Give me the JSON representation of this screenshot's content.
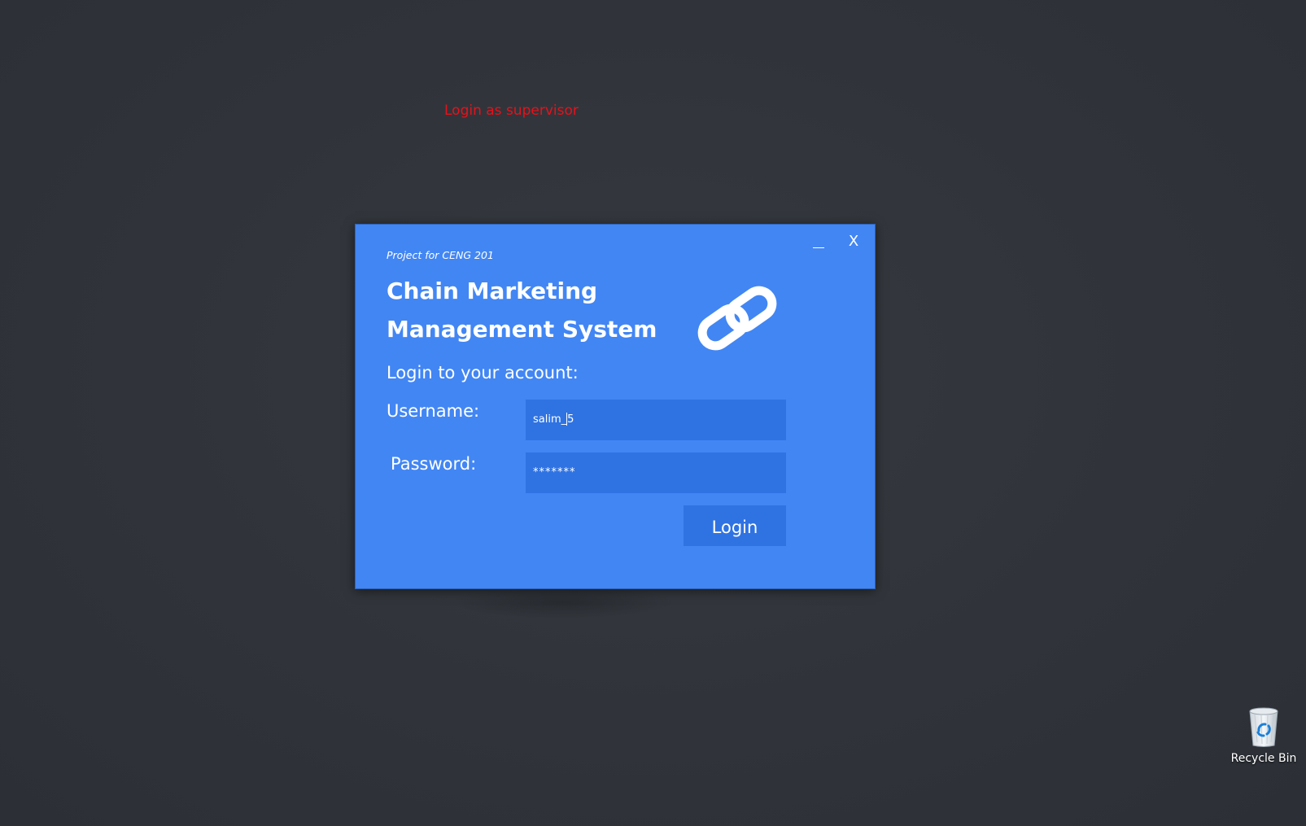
{
  "annotation": {
    "text": "Login as supervisor",
    "color": "#e8111a"
  },
  "dialog": {
    "background_color": "#4286f4",
    "input_color": "#2f73e3",
    "window_controls": {
      "minimize_icon": "minimize-icon",
      "close_label": "X"
    },
    "project_note": "Project for CENG 201",
    "title_line1": "Chain Marketing",
    "title_line2": "Management System",
    "logo_icon": "chain-link-icon",
    "login_prompt": "Login to your account:",
    "username": {
      "label": "Username:",
      "value_before_caret": "salim_",
      "value_after_caret": "5"
    },
    "password": {
      "label": "Password:",
      "value": "*******"
    },
    "login_button_label": "Login"
  },
  "desktop": {
    "recycle_bin": {
      "icon": "recycle-bin-icon",
      "label": "Recycle Bin"
    }
  }
}
